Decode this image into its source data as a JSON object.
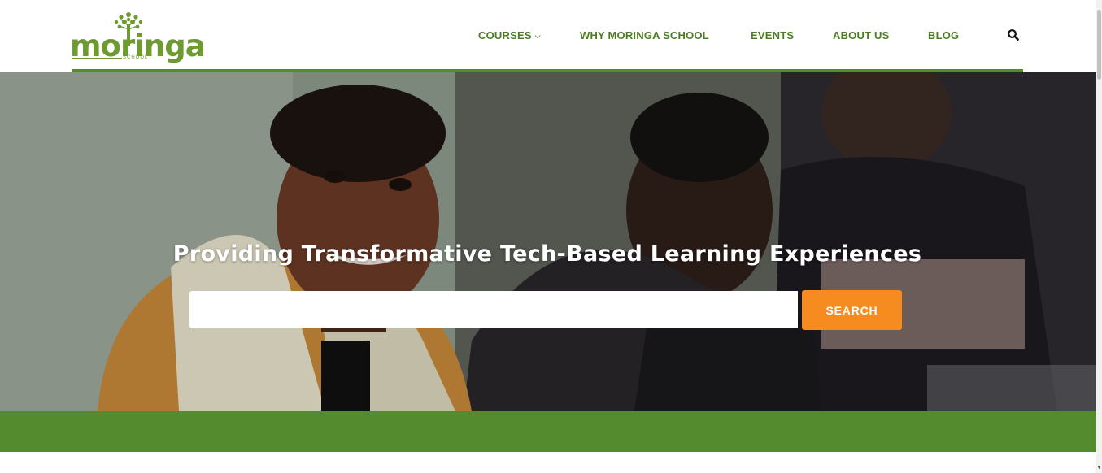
{
  "header": {
    "logo": {
      "name": "moringa",
      "sub": "SCHOOL"
    },
    "nav": [
      {
        "label": "COURSES",
        "has_dropdown": true
      },
      {
        "label": "WHY MORINGA SCHOOL",
        "has_dropdown": false
      },
      {
        "label": "EVENTS",
        "has_dropdown": false
      },
      {
        "label": "ABOUT US",
        "has_dropdown": false
      },
      {
        "label": "BLOG",
        "has_dropdown": false
      }
    ],
    "search_icon": "search-icon",
    "chevron_glyph": "⌵"
  },
  "hero": {
    "title": "Providing Transformative Tech-Based Learning Experiences",
    "search": {
      "value": "",
      "placeholder": "",
      "button_label": "SEARCH"
    }
  },
  "colors": {
    "brand_green": "#558b2f",
    "nav_green": "#4d7d23",
    "logo_green": "#6e9b2f",
    "accent_orange": "#f68b1f"
  }
}
